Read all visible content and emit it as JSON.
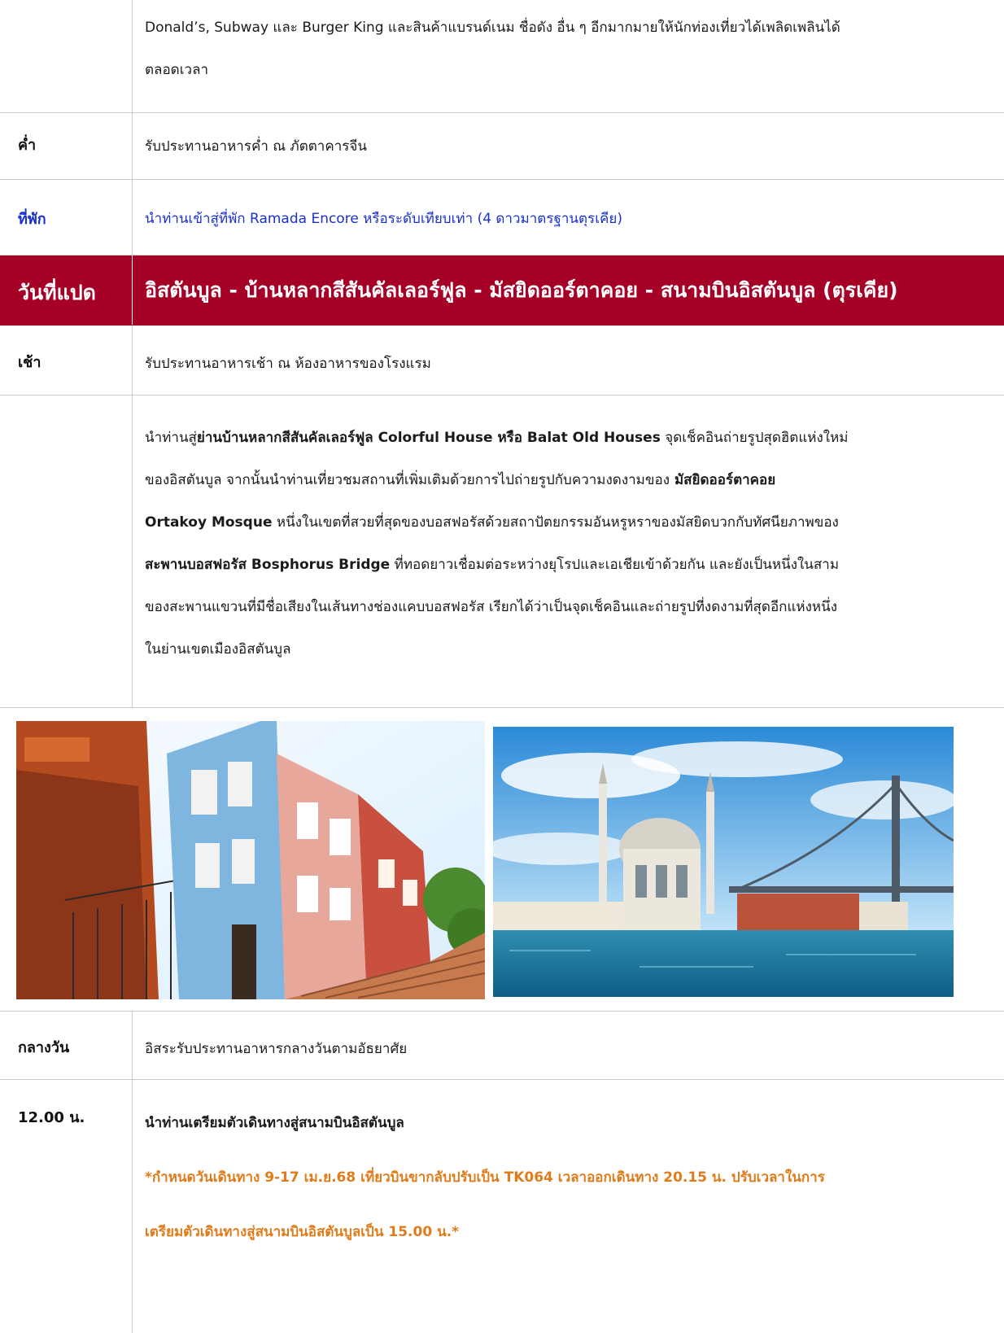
{
  "row1": {
    "label": "",
    "line1": "Donald’s, Subway และ Burger King  และสินค้าแบรนด์เนม ชื่อดัง อื่น ๆ อีกมากมายให้นักท่องเที่ยวได้เพลิดเพลินได้",
    "line2": "ตลอดเวลา"
  },
  "dinner": {
    "label": "ค่ำ",
    "text": "รับประทานอาหารค่ำ ณ ภัตตาคารจีน"
  },
  "hotel": {
    "label": "ที่พัก",
    "text": "นำท่านเข้าสู่ที่พัก Ramada Encore หรือระดับเทียบเท่า (4 ดาวมาตรฐานตุรเคีย)"
  },
  "day8": {
    "label": "วันที่แปด",
    "title": "อิสตันบูล - บ้านหลากสีสันคัลเลอร์ฟูล - มัสยิดออร์ตาคอย - สนามบินอิสตันบูล (ตุรเคีย)"
  },
  "breakfast": {
    "label": "เช้า",
    "text": "รับประทานอาหารเช้า ณ ห้องอาหารของโรงแรม"
  },
  "tour": {
    "l1a": "นำท่านสู่",
    "l1b": "ย่านบ้านหลากสีสันคัลเลอร์ฟูล Colorful House หรือ Balat Old Houses",
    "l1c": " จุดเช็คอินถ่ายรูปสุดฮิตแห่งใหม่",
    "l2a": "ของอิสตันบูล จากนั้นนำท่านเที่ยวชมสถานที่เพิ่มเติมด้วยการไปถ่ายรูปกับความงดงามของ",
    "l2b": " มัสยิดออร์ตาคอย",
    "l3a": "Ortakoy Mosque",
    "l3b": " หนึ่งในเขตที่สวยที่สุดของบอสฟอรัสด้วยสถาปัตยกรรมอันหรูหราของมัสยิดบวกกับทัศนียภาพของ",
    "l4a": "สะพานบอสฟอรัส Bosphorus Bridge",
    "l4b": " ที่ทอดยาวเชื่อมต่อระหว่างยุโรปและเอเชียเข้าด้วยกัน และยังเป็นหนึ่งในสาม",
    "l5": "ของสะพานแขวนที่มีชื่อเสียงในเส้นทางช่องแคบบอสฟอรัส  เรียกได้ว่าเป็นจุดเช็คอินและถ่ายรูปที่งดงามที่สุดอีกแห่งหนึ่ง",
    "l6": "ในย่านเขตเมืองอิสตันบูล"
  },
  "lunch": {
    "label": "กลางวัน",
    "text": "อิสระรับประทานอาหารกลางวันตามอัธยาศัย"
  },
  "transfer": {
    "label": "12.00 น.",
    "text": "นำท่านเตรียมตัวเดินทางสู่สนามบินอิสตันบูล",
    "note1": "*กำหนดวันเดินทาง 9-17 เม.ย.68 เที่ยวบินขากลับปรับเป็น TK064 เวลาออกเดินทาง 20.15 น. ปรับเวลาในการ",
    "note2": "เตรียมตัวเดินทางสู่สนามบินอิสตันบูลเป็น 15.00 น.*"
  },
  "colors": {
    "header": "#a50026",
    "link_blue": "#1a30d0",
    "note_orange": "#e07b1a"
  }
}
